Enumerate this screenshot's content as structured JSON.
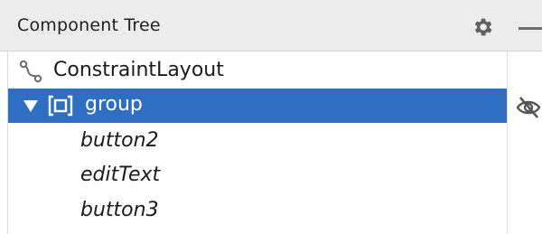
{
  "header": {
    "title": "Component Tree",
    "gear_icon": "gear-icon",
    "minimize_icon": "minus-icon"
  },
  "tree": {
    "root": {
      "label": "ConstraintLayout",
      "icon": "constraint-layout-icon"
    },
    "group": {
      "label": "group",
      "expanded": true,
      "selected": true,
      "icon": "group-icon",
      "visibility_icon": "eye-slash-icon"
    },
    "children": [
      {
        "label": "button2"
      },
      {
        "label": "editText"
      },
      {
        "label": "button3"
      }
    ]
  },
  "colors": {
    "selection": "#2f6fc1",
    "header_bg": "#ececec"
  }
}
